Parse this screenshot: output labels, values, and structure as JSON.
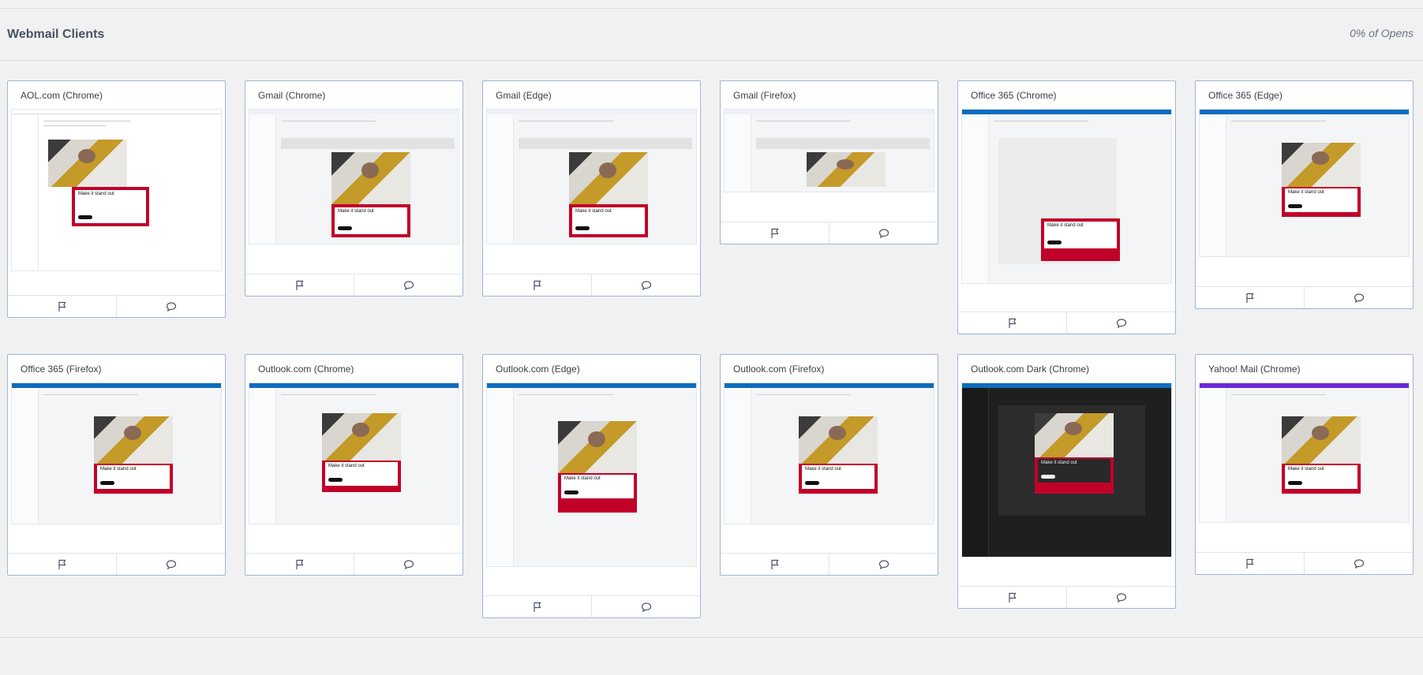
{
  "header": {
    "title": "Webmail Clients",
    "opens": "0% of Opens"
  },
  "email": {
    "headline": "Make it stand out"
  },
  "cards": [
    {
      "title": "AOL.com (Chrome)",
      "theme": "aol"
    },
    {
      "title": "Gmail (Chrome)",
      "theme": "gmail"
    },
    {
      "title": "Gmail (Edge)",
      "theme": "gmail"
    },
    {
      "title": "Gmail (Firefox)",
      "theme": "gmail"
    },
    {
      "title": "Office 365 (Chrome)",
      "theme": "o365"
    },
    {
      "title": "Office 365 (Edge)",
      "theme": "o365"
    },
    {
      "title": "Office 365 (Firefox)",
      "theme": "o365"
    },
    {
      "title": "Outlook.com (Chrome)",
      "theme": "outlook"
    },
    {
      "title": "Outlook.com (Edge)",
      "theme": "outlook"
    },
    {
      "title": "Outlook.com (Firefox)",
      "theme": "outlook"
    },
    {
      "title": "Outlook.com Dark (Chrome)",
      "theme": "dark"
    },
    {
      "title": "Yahoo! Mail (Chrome)",
      "theme": "yahoo"
    }
  ],
  "icons": {
    "flag": "flag-icon",
    "comment": "comment-icon"
  },
  "colors": {
    "accent_red": "#c1002a",
    "outlook_blue": "#0f6cbd",
    "yahoo_purple": "#6d28d9"
  }
}
